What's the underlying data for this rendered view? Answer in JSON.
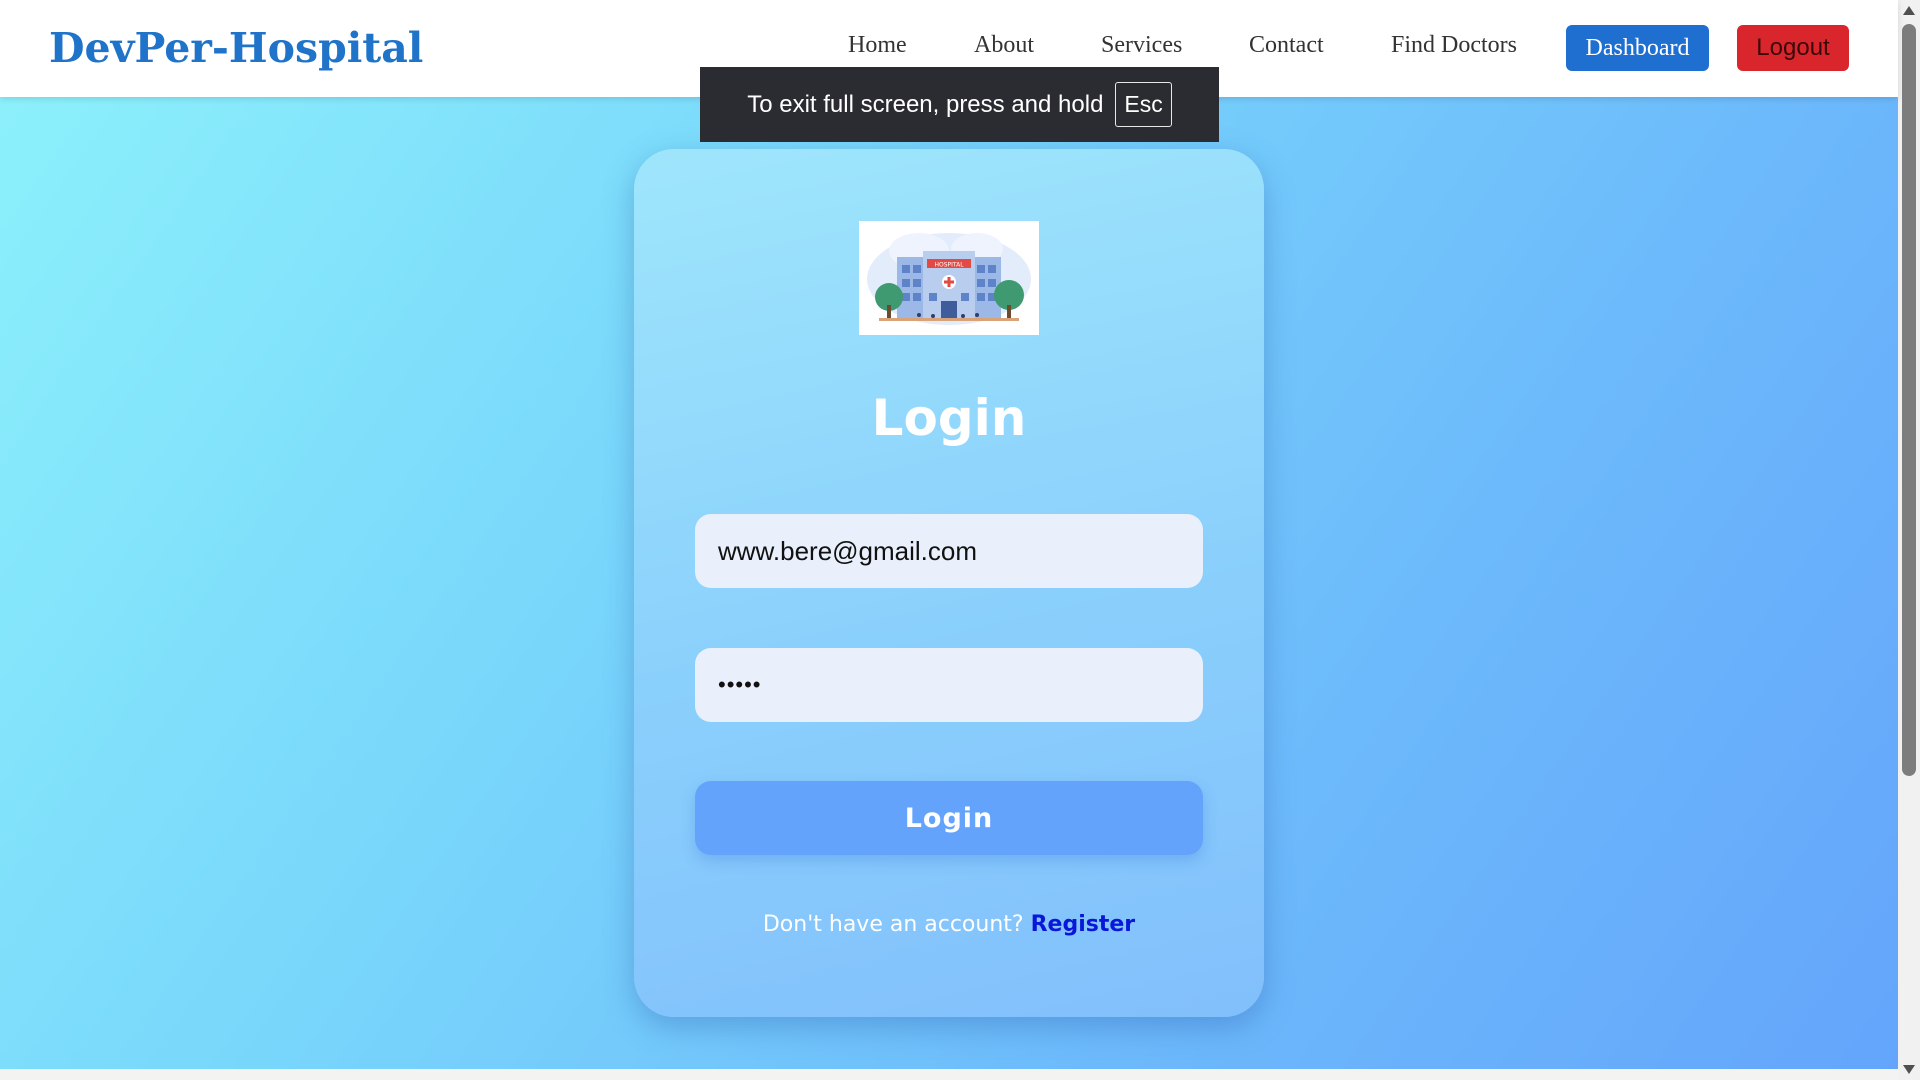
{
  "navbar": {
    "brand": "DevPer-Hospital",
    "links": [
      "Home",
      "About",
      "Services",
      "Contact",
      "Find Doctors"
    ],
    "dashboard_label": "Dashboard",
    "logout_label": "Logout"
  },
  "fullscreen_notice": {
    "text": "To exit full screen, press and hold",
    "key": "Esc"
  },
  "login_card": {
    "hospital_sign": "HOSPITAL",
    "title": "Login",
    "email_value": "www.bere@gmail.com",
    "password_value": "•••••",
    "button_label": "Login",
    "register_prompt": "Don't have an account?",
    "register_link": "Register"
  },
  "colors": {
    "brand": "#1f73c9",
    "dashboard_button": "#1f6fd1",
    "logout_button": "#d9262c",
    "login_button": "#64a3fb",
    "register_link": "#0a16d8"
  }
}
